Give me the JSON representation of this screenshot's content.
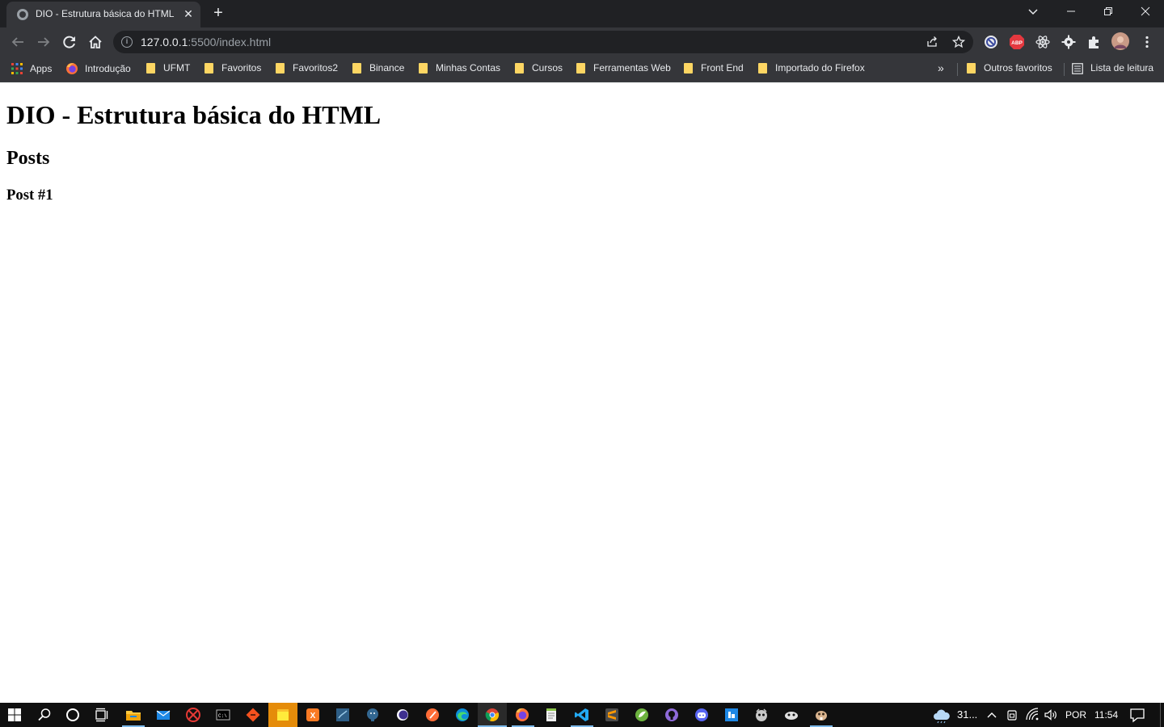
{
  "browser": {
    "tab_title": "DIO - Estrutura básica do HTML",
    "url_host": "127.0.0.1",
    "url_rest": ":5500/index.html",
    "icons": {
      "minimize": "minimize-icon",
      "maximize": "restore-icon",
      "close": "close-icon"
    }
  },
  "bookmarks": {
    "items": [
      {
        "label": "Apps",
        "icon": "apps-grid-icon"
      },
      {
        "label": "Introdução",
        "icon": "firefox-icon"
      },
      {
        "label": "UFMT",
        "icon": "folder-icon"
      },
      {
        "label": "Favoritos",
        "icon": "folder-icon"
      },
      {
        "label": "Favoritos2",
        "icon": "folder-icon"
      },
      {
        "label": "Binance",
        "icon": "folder-icon"
      },
      {
        "label": "Minhas Contas",
        "icon": "folder-icon"
      },
      {
        "label": "Cursos",
        "icon": "folder-icon"
      },
      {
        "label": "Ferramentas Web",
        "icon": "folder-icon"
      },
      {
        "label": "Front End",
        "icon": "folder-icon"
      },
      {
        "label": "Importado do Firefox",
        "icon": "folder-icon"
      }
    ],
    "more": "»",
    "other": "Outros favoritos",
    "reading_list": "Lista de leitura"
  },
  "page": {
    "h1": "DIO - Estrutura básica do HTML",
    "h2": "Posts",
    "h3": "Post #1"
  },
  "taskbar": {
    "weather": "31...",
    "language": "POR",
    "time": "11:54"
  },
  "colors": {
    "tabstrip": "#202124",
    "toolbar": "#35363a",
    "folder": "#fdd663",
    "taskbar": "#101010"
  }
}
